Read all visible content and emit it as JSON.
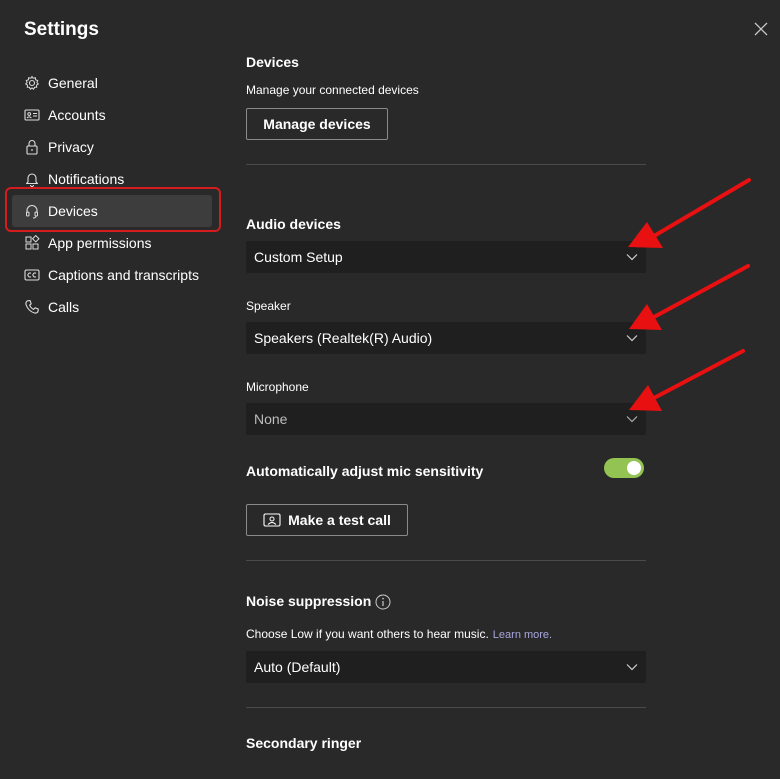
{
  "window": {
    "title": "Settings"
  },
  "sidebar": {
    "items": [
      {
        "label": "General",
        "icon": "gear-icon"
      },
      {
        "label": "Accounts",
        "icon": "id-card-icon"
      },
      {
        "label": "Privacy",
        "icon": "lock-icon"
      },
      {
        "label": "Notifications",
        "icon": "bell-icon"
      },
      {
        "label": "Devices",
        "icon": "headset-icon",
        "active": true
      },
      {
        "label": "App permissions",
        "icon": "app-grid-icon"
      },
      {
        "label": "Captions and transcripts",
        "icon": "cc-icon"
      },
      {
        "label": "Calls",
        "icon": "phone-icon"
      }
    ]
  },
  "devices": {
    "heading": "Devices",
    "description": "Manage your connected devices",
    "manage_button": "Manage devices"
  },
  "audio": {
    "heading": "Audio devices",
    "selected": "Custom Setup",
    "speaker_label": "Speaker",
    "speaker_value": "Speakers (Realtek(R) Audio)",
    "microphone_label": "Microphone",
    "microphone_value": "None",
    "auto_adjust_label": "Automatically adjust mic sensitivity",
    "auto_adjust_on": true,
    "test_call_button": "Make a test call"
  },
  "noise": {
    "heading": "Noise suppression",
    "description": "Choose Low if you want others to hear music.",
    "learn_more": "Learn more.",
    "selected": "Auto (Default)"
  },
  "secondary_ringer": {
    "heading": "Secondary ringer"
  },
  "colors": {
    "background": "#292929",
    "select_background": "#1f1f1f",
    "toggle_on": "#92c353",
    "highlight_outline": "#d41c1c",
    "annotation_arrow": "#e81010",
    "link": "#a6a7dc"
  }
}
